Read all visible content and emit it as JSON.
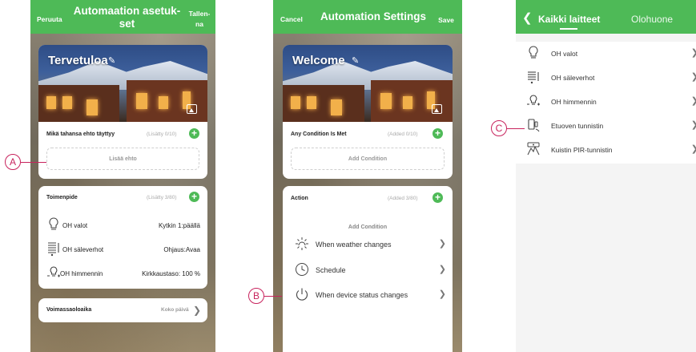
{
  "screen_fi": {
    "header": {
      "cancel": "Peruuta",
      "title": "Automaation asetuk-set",
      "save": "Tallen-na"
    },
    "banner": {
      "title": "Tervetuloa",
      "edit_icon": "pencil-icon",
      "image_icon": "image-icon"
    },
    "condition": {
      "title": "Mikä tahansa ehto täyttyy",
      "count": "(Lisätty 0/10)",
      "add_label": "Lisää ehto"
    },
    "action": {
      "title": "Toimenpide",
      "count": "(Lisätty 3/80)",
      "items": [
        {
          "icon": "bulb-icon",
          "name": "OH valot",
          "value": "Kytkin 1:päällä"
        },
        {
          "icon": "blind-icon",
          "name": "OH säleverhot",
          "value": "Ohjaus:Avaa"
        },
        {
          "icon": "dimmer-icon",
          "name": "OH himmennin",
          "value": "Kirkkaustaso: 100 %"
        }
      ]
    },
    "validity": {
      "title": "Voimassaoloaika",
      "value": "Koko päivä"
    }
  },
  "screen_en": {
    "header": {
      "cancel": "Cancel",
      "title": "Automation Settings",
      "save": "Save"
    },
    "banner": {
      "title": "Welcome"
    },
    "condition": {
      "title": "Any Condition Is Met",
      "count": "(Added 0/10)",
      "add_label": "Add Condition"
    },
    "action": {
      "title": "Action",
      "count": "(Added 3/80)"
    },
    "sheet": {
      "title": "Add Condition",
      "items": [
        {
          "icon": "weather-icon",
          "label": "When weather changes"
        },
        {
          "icon": "clock-icon",
          "label": "Schedule"
        },
        {
          "icon": "power-icon",
          "label": "When device status changes"
        }
      ]
    }
  },
  "screen_devices": {
    "header": {
      "tab_all": "Kaikki laitteet",
      "tab_room": "Olohuone"
    },
    "devices": [
      {
        "icon": "bulb-icon",
        "label": "OH valot"
      },
      {
        "icon": "blind-icon",
        "label": "OH säleverhot"
      },
      {
        "icon": "dimmer-icon",
        "label": "OH himmennin"
      },
      {
        "icon": "door-sensor-icon",
        "label": "Etuoven tunnistin"
      },
      {
        "icon": "pir-sensor-icon",
        "label": "Kuistin PIR-tunnistin"
      }
    ]
  },
  "callouts": {
    "a": "A",
    "b": "B",
    "c": "C"
  },
  "colors": {
    "header_green": "#4eba57",
    "callout": "#c8235d"
  }
}
